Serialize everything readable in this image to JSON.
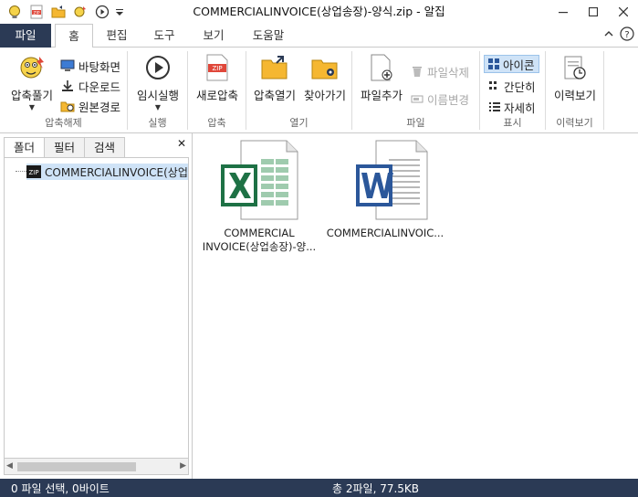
{
  "window": {
    "title": "COMMERCIALINVOICE(상업송장)-양식.zip - 알집"
  },
  "tabs": [
    {
      "label": "파일"
    },
    {
      "label": "홈"
    },
    {
      "label": "편집"
    },
    {
      "label": "도구"
    },
    {
      "label": "보기"
    },
    {
      "label": "도움말"
    }
  ],
  "ribbon": {
    "extract": {
      "label": "압축해제",
      "unzip": "압축풀기",
      "desktop": "바탕화면",
      "download": "다운로드",
      "original": "원본경로"
    },
    "run": {
      "label": "실행",
      "temp_run": "임시실행"
    },
    "compress": {
      "label": "압축",
      "new_zip": "새로압축"
    },
    "open": {
      "label": "열기",
      "open_zip": "압축열기",
      "goto": "찾아가기"
    },
    "file": {
      "label": "파일",
      "add_file": "파일추가",
      "delete_file": "파일삭제",
      "rename": "이름변경"
    },
    "view": {
      "label": "표시",
      "icon": "아이콘",
      "simple": "간단히",
      "detail": "자세히"
    },
    "history": {
      "label": "이력보기",
      "view_history": "이력보기"
    }
  },
  "left_panel": {
    "tabs": [
      "폴더",
      "필터",
      "검색"
    ],
    "tree_root": "COMMERCIALINVOICE(상업송"
  },
  "files": [
    {
      "name_line1": "COMMERCIAL",
      "name_line2": "INVOICE(상업송장)-양...",
      "type": "excel"
    },
    {
      "name_line1": "COMMERCIALINVOIC...",
      "name_line2": "",
      "type": "word"
    }
  ],
  "status": {
    "left": "0 파일 선택,  0바이트",
    "center": "총 2파일,  77.5KB"
  },
  "colors": {
    "accent_dark": "#2b3a55",
    "selection": "#cfe3f7",
    "excel_green": "#1e7145",
    "word_blue": "#2b579a",
    "zip_red": "#e0473a",
    "folder_yellow": "#f5b731"
  }
}
